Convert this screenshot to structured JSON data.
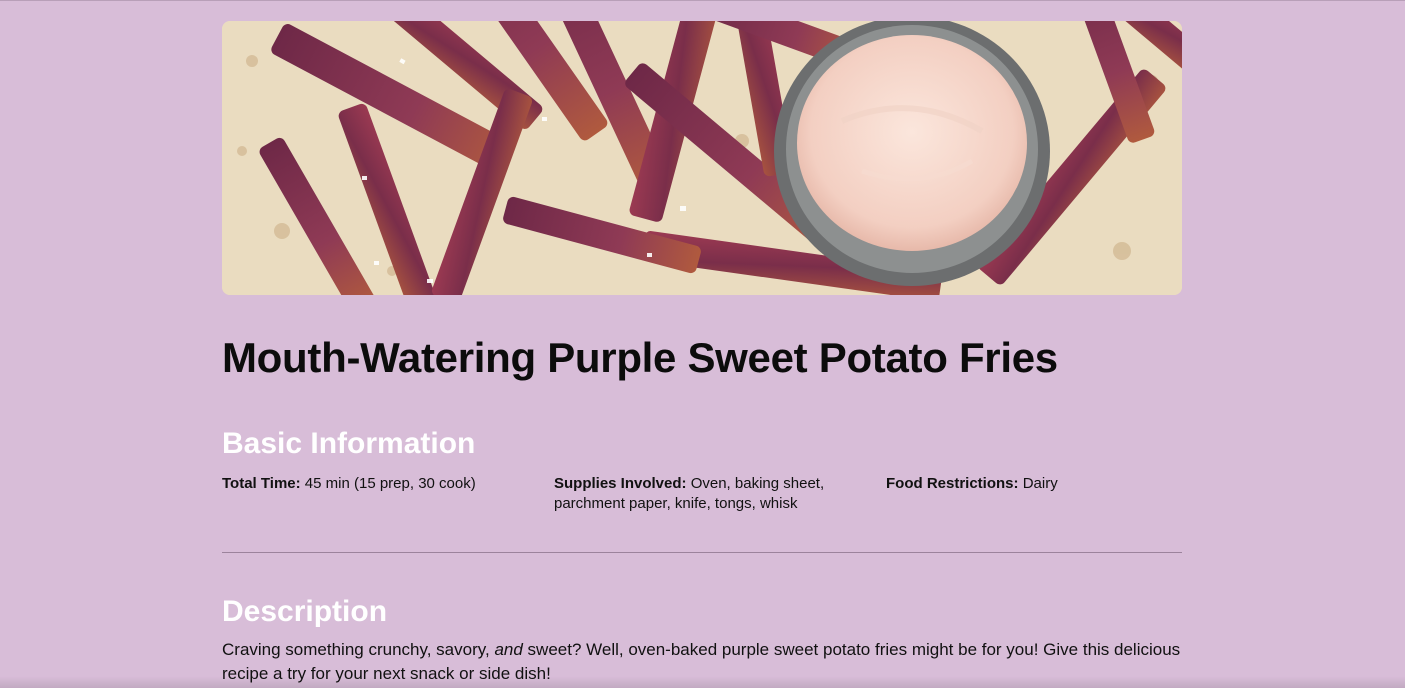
{
  "recipe": {
    "title": "Mouth-Watering Purple Sweet Potato Fries"
  },
  "basic_info": {
    "heading": "Basic Information",
    "total_time_label": "Total Time:",
    "total_time_value": "45 min (15 prep, 30 cook)",
    "supplies_label": "Supplies Involved:",
    "supplies_value": "Oven, baking sheet, parchment paper, knife, tongs, whisk",
    "restrictions_label": "Food Restrictions:",
    "restrictions_value": "Dairy"
  },
  "description": {
    "heading": "Description",
    "text_before": "Craving something crunchy, savory, ",
    "text_emphasis": "and",
    "text_after": " sweet? Well, oven-baked purple sweet potato fries might be for you! Give this delicious recipe a try for your next snack or side dish!"
  },
  "colors": {
    "background": "#d8bdd8",
    "heading_white": "#ffffff",
    "text": "#111111",
    "divider": "#9c839c"
  }
}
